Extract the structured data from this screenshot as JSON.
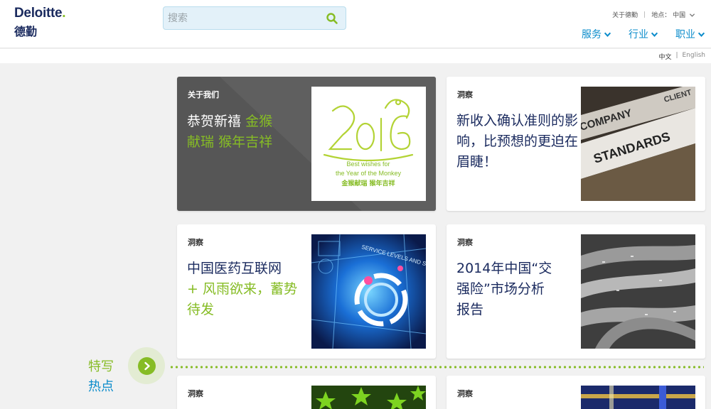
{
  "logo": {
    "brand": "Deloitte",
    "dot": ".",
    "cn": "德勤"
  },
  "search": {
    "placeholder": "搜索"
  },
  "top_links": {
    "about": "关于德勤",
    "location_label": "地点：",
    "location_value": "中国"
  },
  "nav": {
    "services": "服务",
    "industries": "行业",
    "careers": "职业"
  },
  "lang": {
    "zh": "中文",
    "sep": "|",
    "en": "English"
  },
  "cards": [
    {
      "tag": "关于我们",
      "title_white_1": "恭贺新禧",
      "title_green_1": "金猴",
      "title_green_2": "献瑞",
      "title_green_3": "猴年吉祥",
      "img": {
        "year": "2016",
        "line1": "Best wishes for",
        "line2": "the Year of the Monkey",
        "line3": "金猴献瑞 猴年吉祥"
      }
    },
    {
      "tag": "洞察",
      "title": "新收入确认准则的影响，比预想的更迫在眉睫！",
      "img": {
        "word1": "COMPANY",
        "word2": "CLIENT",
        "word3": "STANDARDS"
      }
    },
    {
      "tag": "洞察",
      "title_blue": "中国医药互联网",
      "title_green": "+ 风雨欲来，蓄势待发",
      "img": {
        "text": "SERVICE LEVELS AND ST"
      }
    },
    {
      "tag": "洞察",
      "title": "2014年中国“交强险”市场分析报告"
    },
    {
      "tag": "洞察"
    },
    {
      "tag": "洞察"
    }
  ],
  "featured": {
    "line1": "特写",
    "line2": "热点"
  },
  "colors": {
    "brand_green": "#86bc25",
    "brand_blue": "#0b8ccb",
    "navy": "#1a2a5e"
  }
}
